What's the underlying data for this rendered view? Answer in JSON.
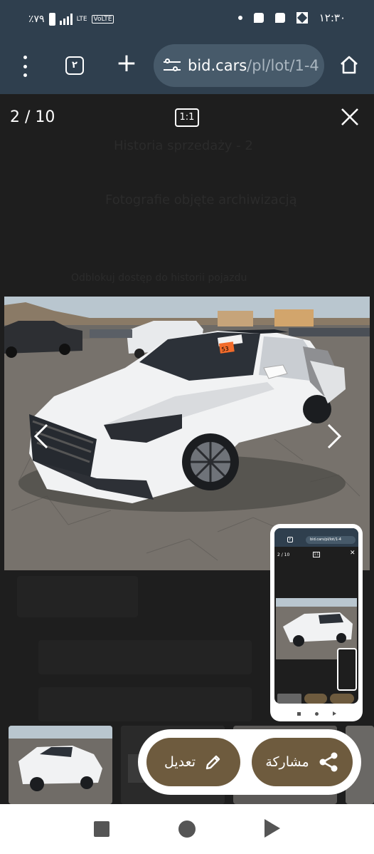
{
  "status_bar": {
    "battery_text": "٪٧٩",
    "network_label": "LTE",
    "volte_label": "VoLTE",
    "time": "١٢:٣٠"
  },
  "browser": {
    "tab_count": "٢",
    "url_host": "bid.cars",
    "url_path": "/pl/lot/1-4"
  },
  "viewer": {
    "counter": "2 / 10",
    "ratio_label": "1:1",
    "faded_background_text": [
      "Historia sprzedaży - 2",
      "Fotografie objęte archiwizacją",
      "Odblokuj dostęp do historii pojazdu"
    ]
  },
  "photo": {
    "subject": "white sedan with damaged right front fender in auction lot",
    "sticky_note_text": "53"
  },
  "thumbnails_count": 4,
  "pip_preview": {
    "counter": "2 / 10",
    "ratio_label": "1:1",
    "url": "bid.cars/pl/lot/1-4",
    "tab_count": "٢"
  },
  "share_bar": {
    "edit_label": "تعديل",
    "share_label": "مشاركة"
  },
  "colors": {
    "chrome": "#2f3f4e",
    "url_pill": "#475a6a",
    "viewer_bg": "#1e1e1e",
    "action_button": "#6e5b3e"
  }
}
